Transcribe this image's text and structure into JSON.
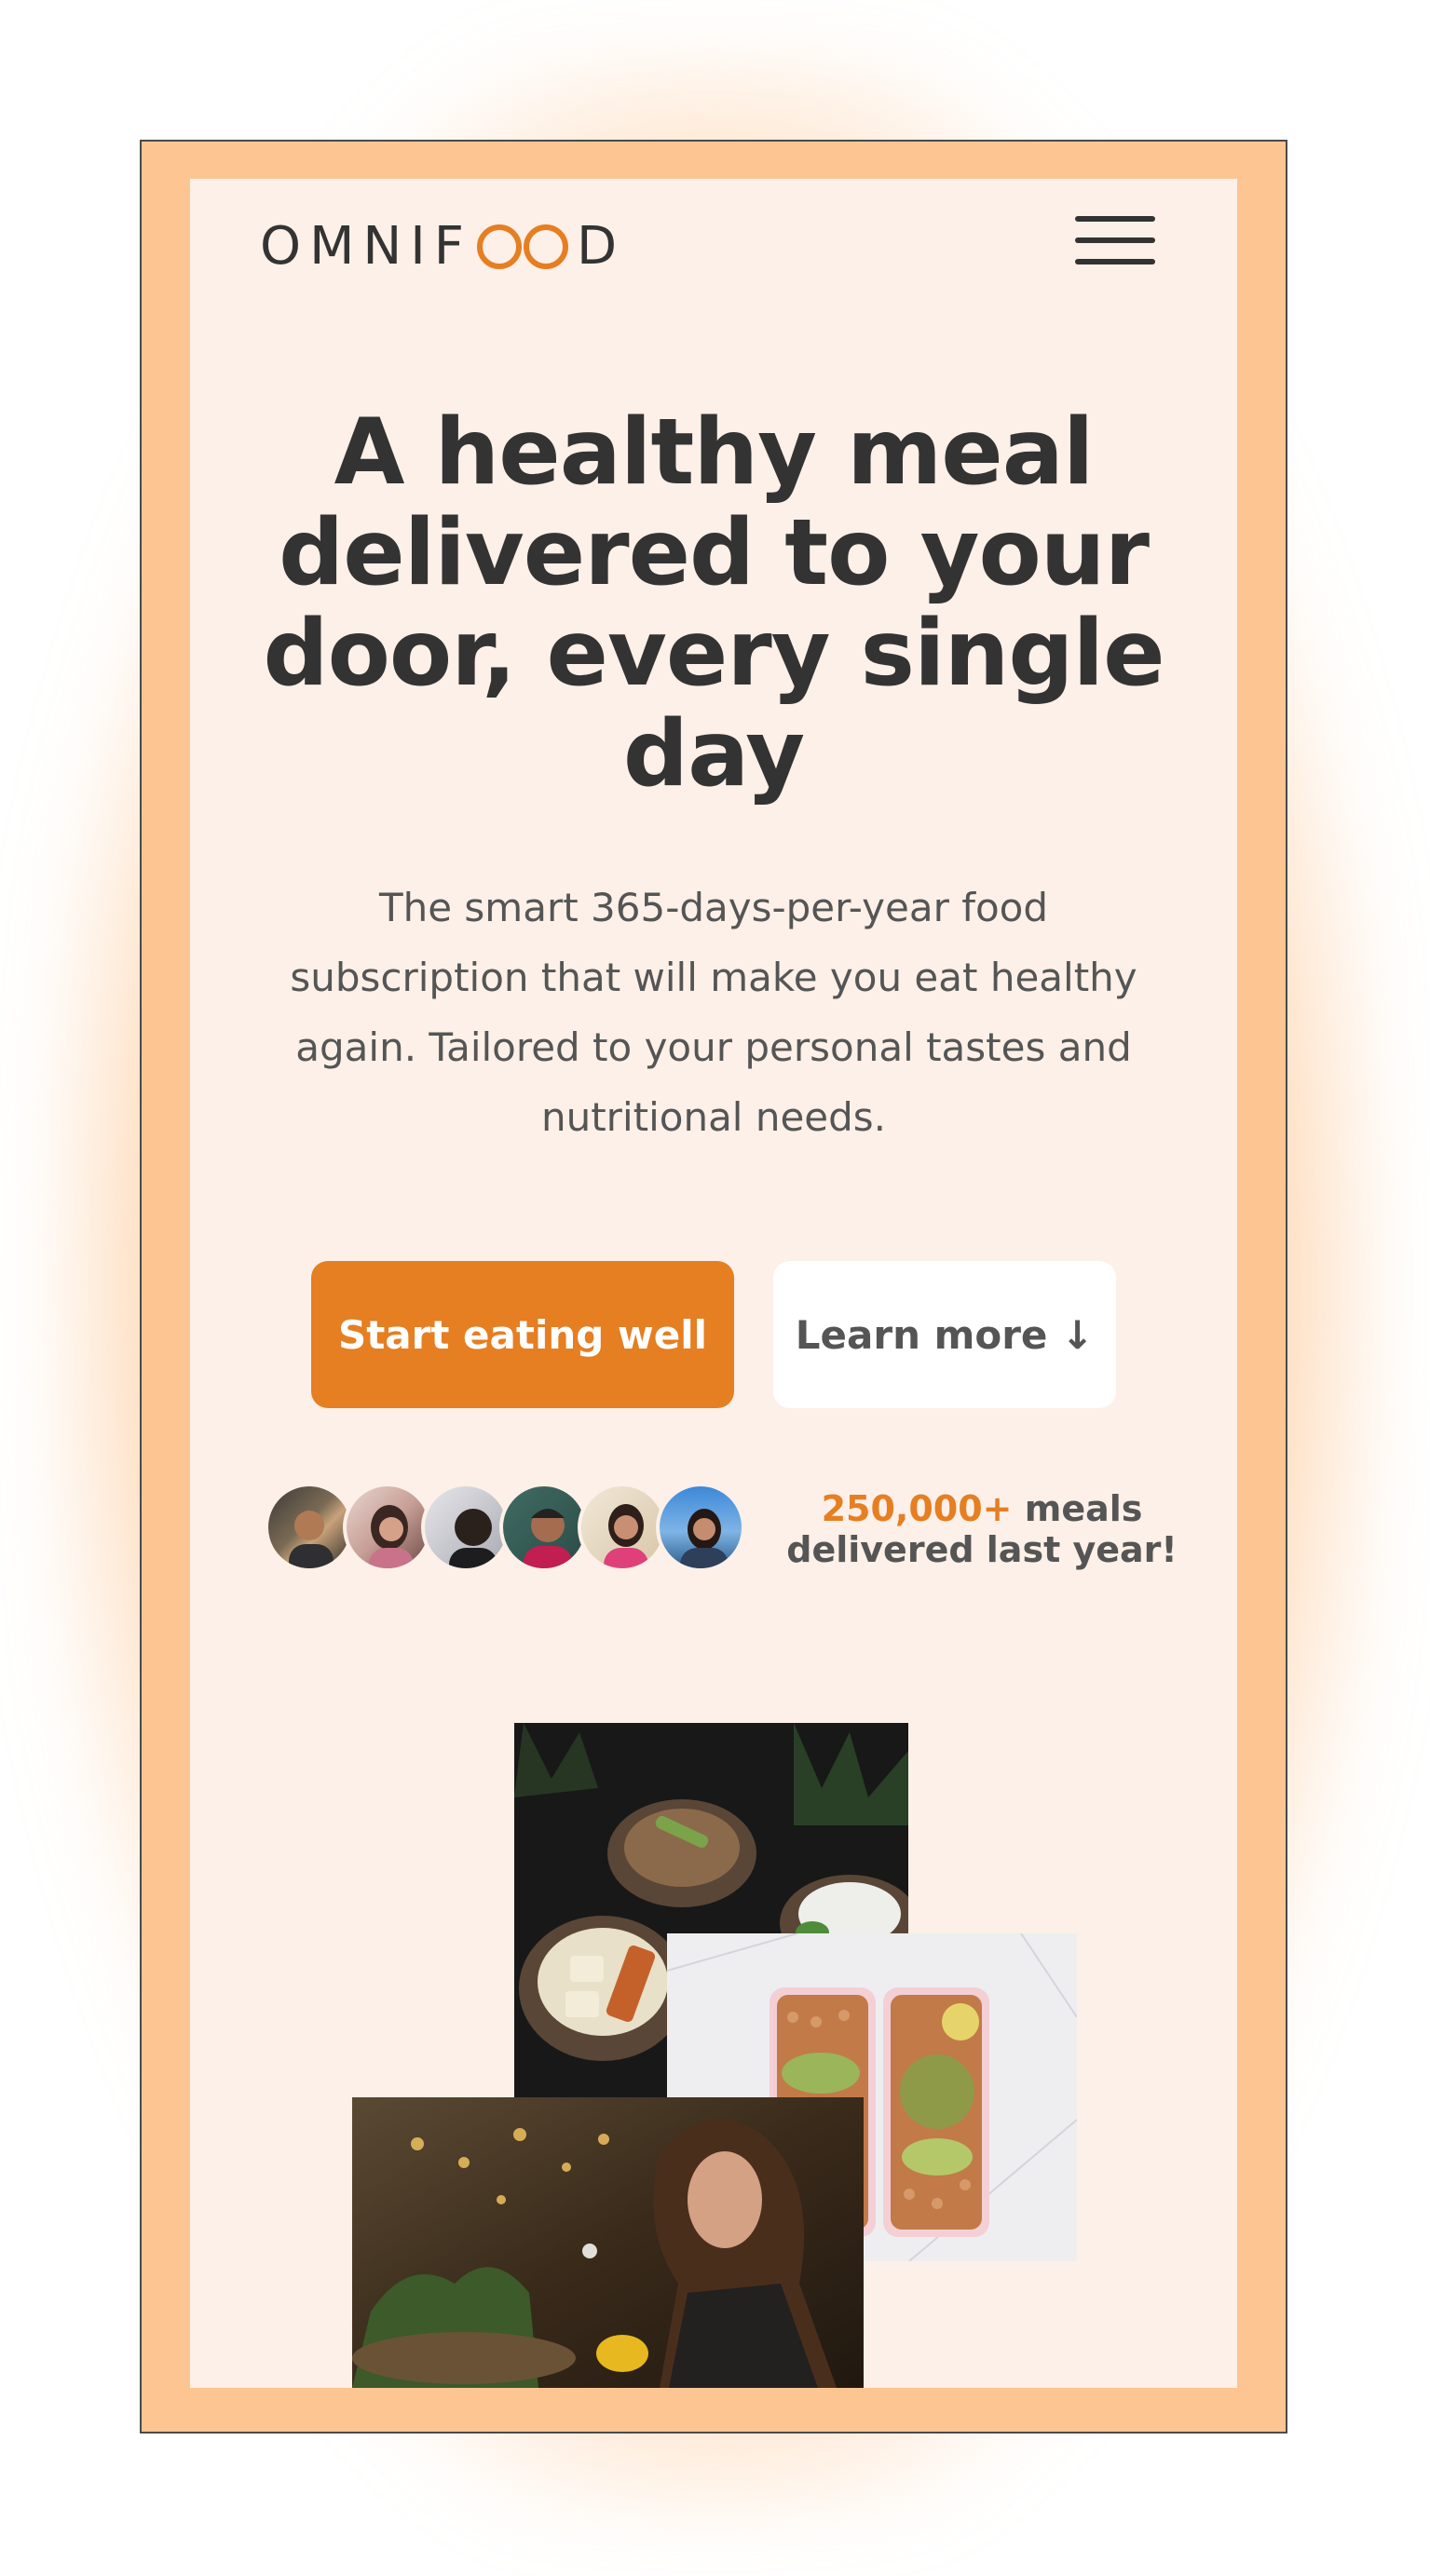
{
  "brand": {
    "logo_left": "OMNIF",
    "logo_right": "D",
    "accent_color": "#e67e22"
  },
  "nav": {
    "menu_icon": "hamburger-menu-icon"
  },
  "hero": {
    "title": "A healthy meal delivered to your door, every single day",
    "description": "The smart 365-days-per-year food subscription that will make you eat healthy again. Tailored to your personal tastes and nutritional needs.",
    "cta_primary": "Start eating well",
    "cta_secondary": "Learn more ↓"
  },
  "delivered": {
    "count": "250,000+",
    "text": "meals delivered last year!"
  },
  "customers": {
    "avatars": [
      "customer-1",
      "customer-2",
      "customer-3",
      "customer-4",
      "customer-5",
      "customer-6"
    ]
  },
  "images": {
    "meal_1": "bowls-meal-photo",
    "meal_2": "meal-prep-boxes-photo",
    "meal_3": "woman-eating-photo"
  }
}
